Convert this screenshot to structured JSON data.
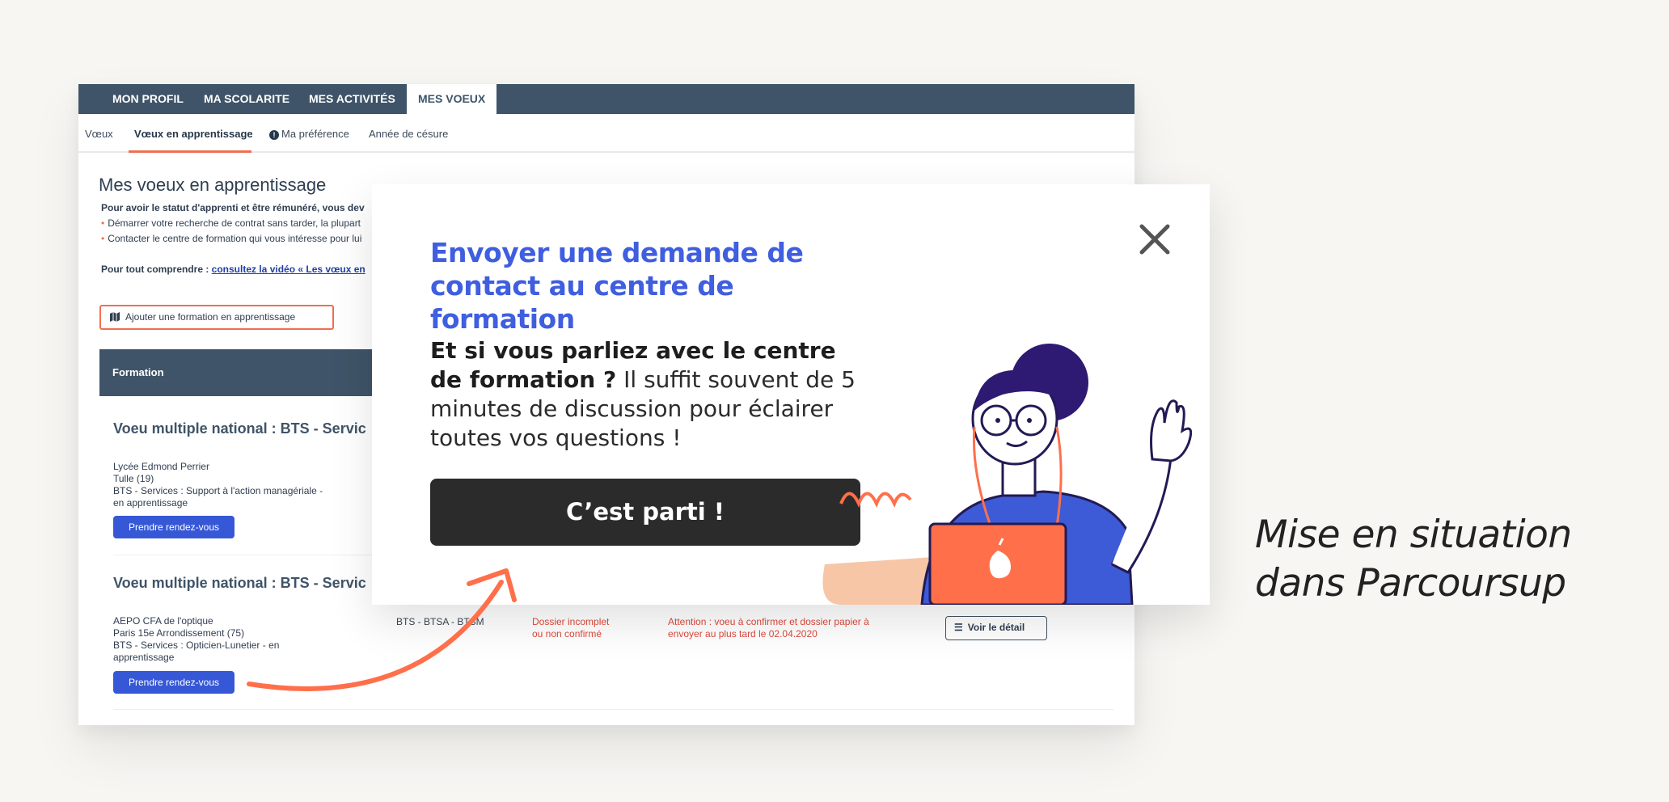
{
  "topnav": {
    "tabs": [
      "MON PROFIL",
      "MA SCOLARITE",
      "MES ACTIVITÉS",
      "MES VOEUX"
    ],
    "active": "MES VOEUX"
  },
  "subnav": {
    "tabs": [
      "Vœux",
      "Vœux en apprentissage",
      "Ma préférence",
      "Année de césure"
    ],
    "active": "Vœux en apprentissage"
  },
  "page": {
    "title": "Mes voeux en apprentissage",
    "intro_line": "Pour avoir le statut d'apprenti et être rémunéré, vous dev",
    "bullet1": "Démarrer votre recherche de contrat sans tarder, la plupart",
    "bullet2": "Contacter le centre de formation qui vous intéresse pour lui",
    "understand_prefix": "Pour tout comprendre : ",
    "understand_link": "consultez la vidéo « Les vœux en",
    "add_button": "Ajouter une formation en apprentissage",
    "table_header": "Formation"
  },
  "voeux": [
    {
      "title": "Voeu multiple national : BTS - Servic",
      "school_lines": [
        "Lycée Edmond Perrier",
        "Tulle (19)",
        "BTS - Services : Support à l'action managériale -",
        "en apprentissage"
      ],
      "button": "Prendre rendez-vous"
    },
    {
      "title": "Voeu multiple national : BTS - Servic",
      "school_lines": [
        "AEPO CFA de l'optique",
        "Paris 15e Arrondissement (75)",
        "BTS - Services : Opticien-Lunetier - en",
        "apprentissage"
      ],
      "button": "Prendre rendez-vous",
      "code": "BTS - BTSA - BTSM",
      "status_lines": [
        "Dossier incomplet",
        "ou non confirmé"
      ],
      "warning_lines": [
        "Attention : voeu à confirmer et dossier papier à",
        "envoyer au plus tard le 02.04.2020"
      ],
      "detail_button": "Voir le détail"
    }
  ],
  "modal": {
    "title_line1": "Envoyer une demande de",
    "title_line2": "contact au centre de formation",
    "text_bold": "Et si vous parliez avec le centre de formation ?",
    "text_regular": " Il suffit souvent de 5 minutes de discussion pour éclairer toutes vos questions !",
    "button": "C’est parti !",
    "close_icon": "close-icon"
  },
  "caption": {
    "line1": "Mise en situation",
    "line2": "dans Parcoursup"
  },
  "colors": {
    "nav": "#3f5468",
    "accent": "#ef6f53",
    "primary_blue": "#3658d6",
    "modal_title": "#3f5ee0",
    "dark_button": "#2b2b2b"
  }
}
